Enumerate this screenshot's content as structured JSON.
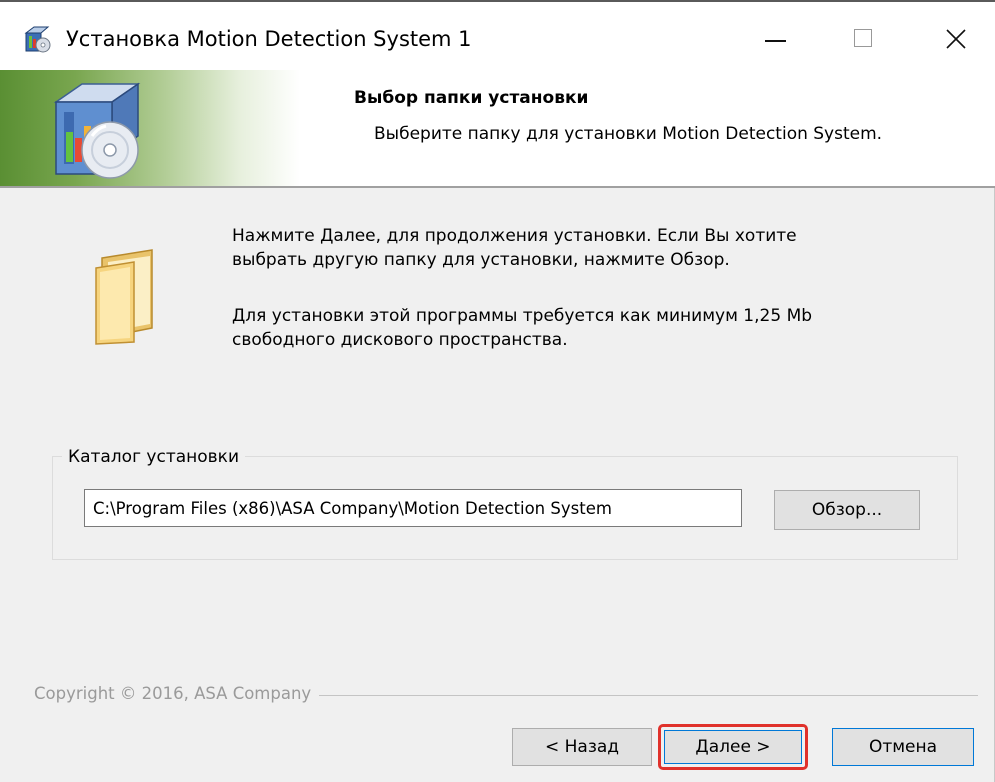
{
  "window": {
    "title": "Установка Motion Detection System 1"
  },
  "header": {
    "title": "Выбор папки установки",
    "subtitle": "Выберите папку для установки Motion Detection System."
  },
  "body": {
    "line1": "Нажмите Далее, для продолжения установки. Если Вы хотите",
    "line2": "выбрать другую папку для установки, нажмите Обзор.",
    "line3": "Для установки этой программы требуется как минимум 1,25 Mb",
    "line4": "свободного дискового пространства."
  },
  "destination": {
    "group_label": "Каталог установки",
    "path": "C:\\Program Files (x86)\\ASA Company\\Motion Detection System",
    "browse_label": "Обзор..."
  },
  "footer": {
    "copyright": "Copyright © 2016, ASA Company",
    "back_label": "< Назад",
    "next_label": "Далее >",
    "cancel_label": "Отмена"
  },
  "colors": {
    "header_gradient_start": "#5a8f33",
    "highlight": "#e0312b",
    "focus_border": "#0078d7",
    "dialog_bg": "#f0f0f0"
  },
  "icons": {
    "title": "installer-box-icon",
    "header": "installer-cd-icon",
    "body": "folder-icon",
    "minimize": "minimize-icon",
    "maximize": "maximize-icon",
    "close": "close-icon"
  }
}
